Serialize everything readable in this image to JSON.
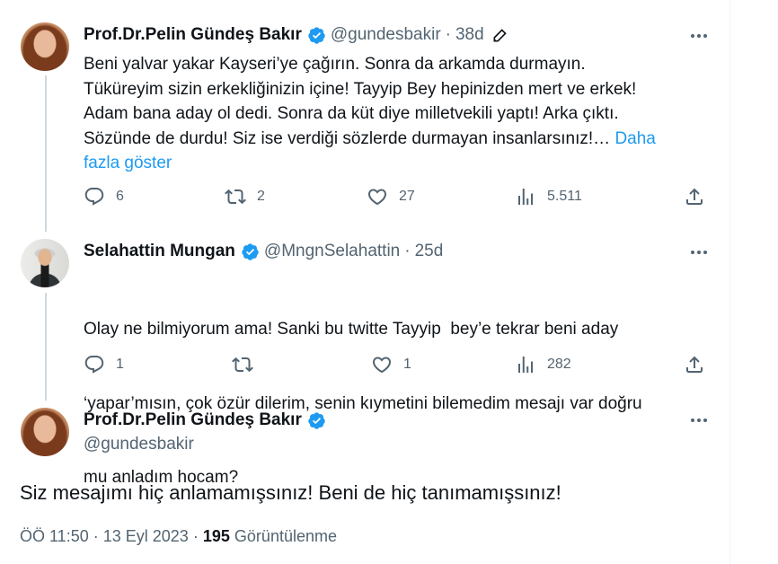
{
  "colors": {
    "accent": "#1d9bf0",
    "text": "#0f1419",
    "secondary": "#536471",
    "line": "#cfd9de"
  },
  "tweet1": {
    "name": "Prof.Dr.Pelin Gündeş Bakır",
    "handle": "@gundesbakir",
    "separator": "·",
    "time": "38d",
    "text_lines": [
      "Beni yalvar yakar Kayseri’ye çağırın. Sonra da arkamda durmayın.",
      "Tüküreyim sizin erkekliğinizin içine! Tayyip Bey hepinizden mert ve erkek!",
      "Adam bana aday ol dedi. Sonra da küt diye milletvekili yaptı! Arka çıktı.",
      "Sözünde de durdu! Siz ise verdiği sözlerde durmayan insanlarsınız!…"
    ],
    "show_more_1": "Daha",
    "show_more_2": "fazla göster",
    "replies": "6",
    "retweets": "2",
    "likes": "27",
    "views": "5.511"
  },
  "tweet2": {
    "name": "Selahattin Mungan",
    "handle": "@MngnSelahattin",
    "separator": "·",
    "time": "25d",
    "text_lines": [
      "Olay ne bilmiyorum ama! Sanki bu twitte Tayyip  bey’e tekrar beni aday",
      "‘yapar’mısın, çok özür dilerim, senin kıymetini bilemedim mesajı var doğru",
      "mu anladım hocam?"
    ],
    "replies": "1",
    "retweets": "",
    "likes": "1",
    "views": "282"
  },
  "tweet3": {
    "name": "Prof.Dr.Pelin Gündeş Bakır",
    "handle": "@gundesbakir",
    "text": "Siz mesajımı hiç anlamamışsınız! Beni de hiç tanımamışsınız!",
    "time": "ÖÖ 11:50",
    "date": "13 Eyl 2023",
    "separator": "·",
    "views_count": "195",
    "views_label": "Görüntülenme"
  },
  "icons": {
    "verified": "verified-badge-icon",
    "edit": "edit-pencil-icon",
    "more": "more-dots-icon",
    "reply": "reply-bubble-icon",
    "retweet": "retweet-icon",
    "like": "heart-icon",
    "views": "views-bar-chart-icon",
    "share": "share-upload-icon"
  }
}
